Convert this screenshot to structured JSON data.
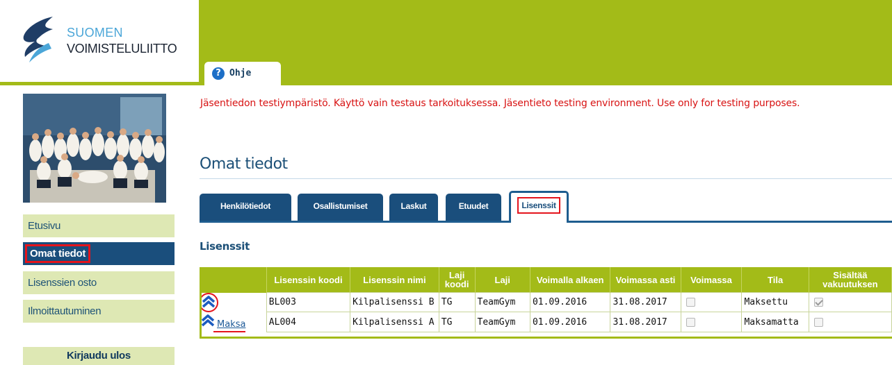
{
  "brand": {
    "line1": "SUOMEN",
    "line2": "VOIMISTELULIITTO"
  },
  "help": {
    "label": "Ohje",
    "icon": "help-circle-icon"
  },
  "sidebar": {
    "items": [
      {
        "label": "Etusivu"
      },
      {
        "label": "Omat tiedot"
      },
      {
        "label": "Lisenssien osto"
      },
      {
        "label": "Ilmoittautuminen"
      }
    ],
    "logout": "Kirjaudu ulos"
  },
  "notice": "Jäsentiedon testiympäristö. Käyttö vain testaus tarkoituksessa. Jäsentieto testing environment. Use only for testing purposes.",
  "page_title": "Omat tiedot",
  "tabs": [
    {
      "label": "Henkilötiedot"
    },
    {
      "label": "Osallistumiset"
    },
    {
      "label": "Laskut"
    },
    {
      "label": "Etuudet"
    },
    {
      "label": "Lisenssit"
    }
  ],
  "section_title": "Lisenssit",
  "table": {
    "headers": {
      "code": "Lisenssin koodi",
      "name": "Lisenssin nimi",
      "sport_code": "Laji koodi",
      "sport": "Laji",
      "valid_from": "Voimalla alkaen",
      "valid_to": "Voimassa asti",
      "active": "Voimassa",
      "status": "Tila",
      "insurance": "Sisältää vakuutuksen"
    },
    "rows": [
      {
        "code": "BL003",
        "name": "Kilpalisenssi B",
        "sport_code": "TG",
        "sport": "TeamGym",
        "valid_from": "01.09.2016",
        "valid_to": "31.08.2017",
        "active": false,
        "status": "Maksettu",
        "insurance": true,
        "action": ""
      },
      {
        "code": "AL004",
        "name": "Kilpalisenssi A",
        "sport_code": "TG",
        "sport": "TeamGym",
        "valid_from": "01.09.2016",
        "valid_to": "31.08.2017",
        "active": false,
        "status": "Maksamatta",
        "insurance": false,
        "action": "Maksa"
      }
    ]
  },
  "colors": {
    "banner": "#a3bb18",
    "nav_active": "#1a4e7c",
    "highlight": "#e4141c",
    "notice": "#d81313"
  }
}
